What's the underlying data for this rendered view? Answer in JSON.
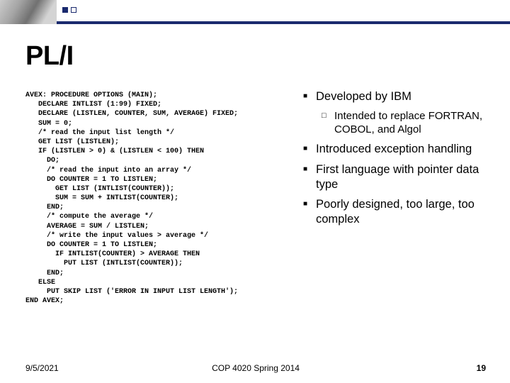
{
  "title": "PL/I",
  "code": "AVEX: PROCEDURE OPTIONS (MAIN);\n   DECLARE INTLIST (1:99) FIXED;\n   DECLARE (LISTLEN, COUNTER, SUM, AVERAGE) FIXED;\n   SUM = 0;\n   /* read the input list length */\n   GET LIST (LISTLEN);\n   IF (LISTLEN > 0) & (LISTLEN < 100) THEN\n     DO;\n     /* read the input into an array */\n     DO COUNTER = 1 TO LISTLEN;\n       GET LIST (INTLIST(COUNTER));\n       SUM = SUM + INTLIST(COUNTER);\n     END;\n     /* compute the average */\n     AVERAGE = SUM / LISTLEN;\n     /* write the input values > average */\n     DO COUNTER = 1 TO LISTLEN;\n       IF INTLIST(COUNTER) > AVERAGE THEN\n         PUT LIST (INTLIST(COUNTER));\n     END;\n   ELSE\n     PUT SKIP LIST ('ERROR IN INPUT LIST LENGTH');\nEND AVEX;",
  "bullets": {
    "b1": "Developed by IBM",
    "b1a": "Intended to replace FORTRAN, COBOL, and Algol",
    "b2": "Introduced exception handling",
    "b3": "First language with pointer data type",
    "b4": "Poorly designed, too large, too complex"
  },
  "footer": {
    "date": "9/5/2021",
    "course": "COP 4020 Spring 2014",
    "page": "19"
  }
}
